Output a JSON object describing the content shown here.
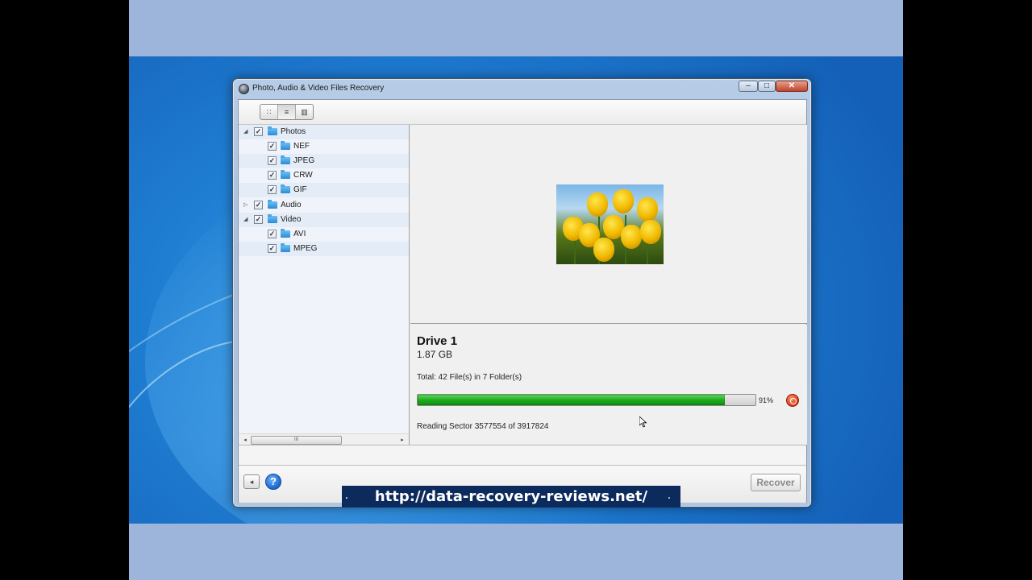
{
  "window": {
    "title": "Photo, Audio & Video Files Recovery",
    "controls": {
      "minimize": "–",
      "maximize": "□",
      "close": "✕"
    }
  },
  "toolbar": {
    "view_buttons": [
      {
        "icon": "thumbnails-view-icon",
        "glyph": "∷"
      },
      {
        "icon": "list-view-icon",
        "glyph": "≡"
      },
      {
        "icon": "filmstrip-view-icon",
        "glyph": "▥"
      }
    ]
  },
  "tree": {
    "items": [
      {
        "label": "Photos",
        "level": 0,
        "expanded": true,
        "checked": true
      },
      {
        "label": "NEF",
        "level": 1,
        "checked": true
      },
      {
        "label": "JPEG",
        "level": 1,
        "checked": true
      },
      {
        "label": "CRW",
        "level": 1,
        "checked": true
      },
      {
        "label": "GIF",
        "level": 1,
        "checked": true
      },
      {
        "label": "Audio",
        "level": 0,
        "expanded": false,
        "checked": true
      },
      {
        "label": "Video",
        "level": 0,
        "expanded": true,
        "checked": true
      },
      {
        "label": "AVI",
        "level": 1,
        "checked": true
      },
      {
        "label": "MPEG",
        "level": 1,
        "checked": true
      }
    ],
    "check_glyph": "✓",
    "expanded_glyph": "◢",
    "collapsed_glyph": "▷",
    "scroll_left": "◂",
    "scroll_right": "▸",
    "scroll_grip": "III"
  },
  "info": {
    "drive_title": "Drive 1",
    "drive_size": "1.87 GB",
    "total": "Total: 42 File(s) in 7 Folder(s)",
    "progress_percent": 91,
    "progress_label": "91%",
    "reading": "Reading Sector  3577554 of 3917824"
  },
  "footer": {
    "back_glyph": "◂",
    "help_glyph": "?",
    "recover_label": "Recover"
  },
  "banner": {
    "url": "http://data-recovery-reviews.net/"
  }
}
